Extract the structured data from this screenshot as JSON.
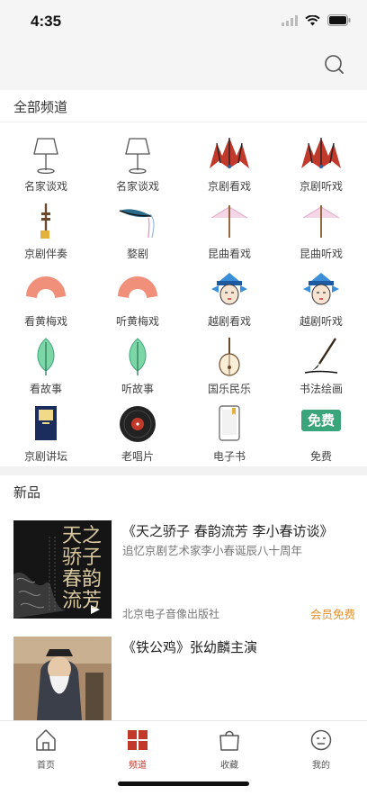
{
  "status": {
    "time": "4:35"
  },
  "channels": {
    "header": "全部频道",
    "items": [
      {
        "label": "名家谈戏",
        "icon": "lamp-icon"
      },
      {
        "label": "名家谈戏",
        "icon": "lamp-icon"
      },
      {
        "label": "京剧看戏",
        "icon": "opera-crown-icon"
      },
      {
        "label": "京剧听戏",
        "icon": "opera-crown-icon"
      },
      {
        "label": "京剧伴奏",
        "icon": "jinghu-icon"
      },
      {
        "label": "婺剧",
        "icon": "headdress-icon"
      },
      {
        "label": "昆曲看戏",
        "icon": "parasol-icon"
      },
      {
        "label": "昆曲听戏",
        "icon": "parasol-icon"
      },
      {
        "label": "看黄梅戏",
        "icon": "fan-icon"
      },
      {
        "label": "听黄梅戏",
        "icon": "fan-icon"
      },
      {
        "label": "越剧看戏",
        "icon": "opera-face-icon"
      },
      {
        "label": "越剧听戏",
        "icon": "opera-face-icon"
      },
      {
        "label": "看故事",
        "icon": "leaf-icon"
      },
      {
        "label": "听故事",
        "icon": "leaf-icon"
      },
      {
        "label": "国乐民乐",
        "icon": "pipa-icon"
      },
      {
        "label": "书法绘画",
        "icon": "brush-icon"
      },
      {
        "label": "京剧讲坛",
        "icon": "book-icon"
      },
      {
        "label": "老唱片",
        "icon": "vinyl-record-icon"
      },
      {
        "label": "电子书",
        "icon": "ebook-icon"
      },
      {
        "label": "免费",
        "icon": "free-badge-icon",
        "badge_text": "免费"
      }
    ]
  },
  "new_section": {
    "header": "新品",
    "items": [
      {
        "title": "《天之骄子 春韵流芳 李小春访谈》",
        "subtitle": "追忆京剧艺术家李小春诞辰八十周年",
        "publisher": "北京电子音像出版社",
        "badge": "会员免费",
        "cover_text": "天之骄子 春韵流芳"
      },
      {
        "title": "《铁公鸡》张幼麟主演"
      }
    ]
  },
  "tabs": [
    {
      "label": "首页",
      "icon": "home-icon",
      "active": false
    },
    {
      "label": "频道",
      "icon": "grid-icon",
      "active": true
    },
    {
      "label": "收藏",
      "icon": "bag-icon",
      "active": false
    },
    {
      "label": "我的",
      "icon": "face-icon",
      "active": false
    }
  ],
  "colors": {
    "accent": "#c0392b",
    "badge": "#e8902b",
    "free_green": "#3aa57a"
  }
}
